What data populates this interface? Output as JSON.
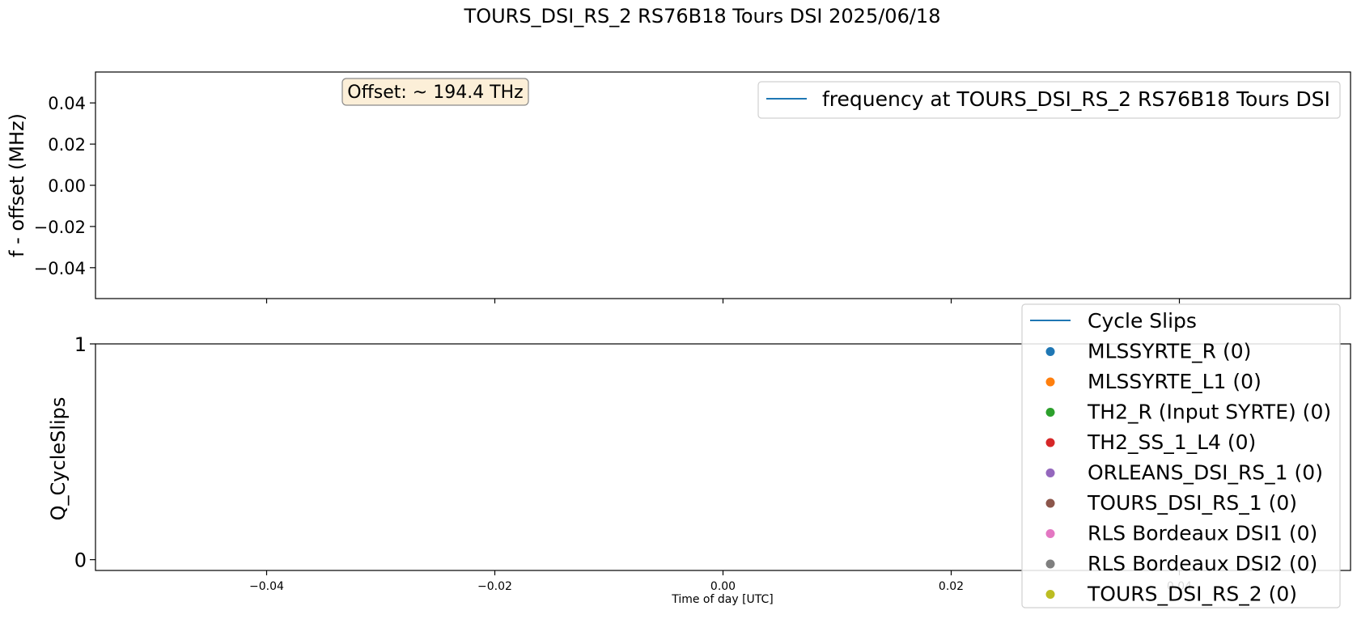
{
  "figure": {
    "title": "TOURS_DSI_RS_2 RS76B18 Tours DSI 2025/06/18"
  },
  "chart_data": [
    {
      "type": "line",
      "ylabel": "f - offset (MHz)",
      "xlabel": "",
      "xlim": [
        -0.055,
        0.055
      ],
      "ylim": [
        -0.055,
        0.055
      ],
      "xticks": [
        -0.04,
        -0.02,
        0.0,
        0.02,
        0.04
      ],
      "xtick_labels_visible": false,
      "yticks": [
        -0.04,
        -0.02,
        0.0,
        0.02,
        0.04
      ],
      "ytick_labels": [
        "−0.04",
        "−0.02",
        "0.00",
        "0.02",
        "0.04"
      ],
      "grid": false,
      "legend_placement": "top-right",
      "series": [
        {
          "name": "frequency at TOURS_DSI_RS_2 RS76B18 Tours DSI",
          "x": [],
          "y": [],
          "color": "#1f77b4"
        }
      ],
      "annotation": {
        "text": "Offset: ~ 194.4 THz",
        "placement": "top-left"
      }
    },
    {
      "type": "scatter",
      "ylabel": "Q_CycleSlips",
      "xlabel": "Time of day [UTC]",
      "xlim": [
        -0.055,
        0.055
      ],
      "ylim": [
        -0.05,
        1.0
      ],
      "xticks": [
        -0.04,
        -0.02,
        0.0,
        0.02,
        0.04
      ],
      "xtick_labels": [
        "−0.04",
        "−0.02",
        "0.00",
        "0.02",
        "0.04"
      ],
      "yticks": [
        0,
        1
      ],
      "ytick_labels": [
        "0",
        "1"
      ],
      "grid": false,
      "legend_placement": "right (overlapping)",
      "legend": [
        {
          "name": "Cycle Slips",
          "marker": "line",
          "color": "#1f77b4"
        },
        {
          "name": "MLSSYRTE_R (0)",
          "marker": "dot",
          "color": "#1f77b4"
        },
        {
          "name": "MLSSYRTE_L1 (0)",
          "marker": "dot",
          "color": "#ff7f0e"
        },
        {
          "name": "TH2_R (Input SYRTE) (0)",
          "marker": "dot",
          "color": "#2ca02c"
        },
        {
          "name": "TH2_SS_1_L4 (0)",
          "marker": "dot",
          "color": "#d62728"
        },
        {
          "name": "ORLEANS_DSI_RS_1 (0)",
          "marker": "dot",
          "color": "#9467bd"
        },
        {
          "name": "TOURS_DSI_RS_1 (0)",
          "marker": "dot",
          "color": "#8c564b"
        },
        {
          "name": "RLS Bordeaux DSI1 (0)",
          "marker": "dot",
          "color": "#e377c2"
        },
        {
          "name": "RLS Bordeaux DSI2 (0)",
          "marker": "dot",
          "color": "#7f7f7f"
        },
        {
          "name": "TOURS_DSI_RS_2 (0)",
          "marker": "dot",
          "color": "#bcbd22"
        }
      ]
    }
  ]
}
